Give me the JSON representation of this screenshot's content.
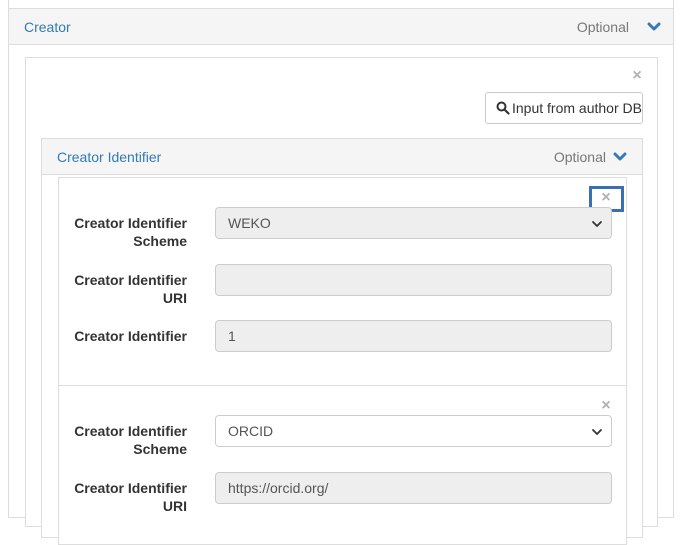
{
  "creator_panel": {
    "title": "Creator",
    "optional_label": "Optional"
  },
  "author_button": {
    "label": "Input from author DB",
    "icon": "search-icon"
  },
  "identifier_panel": {
    "title": "Creator Identifier",
    "optional_label": "Optional"
  },
  "identifier_items": [
    {
      "scheme_label": "Creator Identifier Scheme",
      "scheme_value": "WEKO",
      "uri_label": "Creator Identifier URI",
      "uri_value": "",
      "identifier_label": "Creator Identifier",
      "identifier_value": "1"
    },
    {
      "scheme_label": "Creator Identifier Scheme",
      "scheme_value": "ORCID",
      "uri_label": "Creator Identifier URI",
      "uri_value": "https://orcid.org/"
    }
  ],
  "icons": {
    "remove": "×",
    "chevron": "chevron-down-icon"
  },
  "colors": {
    "link": "#337ab7",
    "focus": "#3a6fb5",
    "heading_bg": "#f5f5f5",
    "disabled_bg": "#eeeeee"
  }
}
